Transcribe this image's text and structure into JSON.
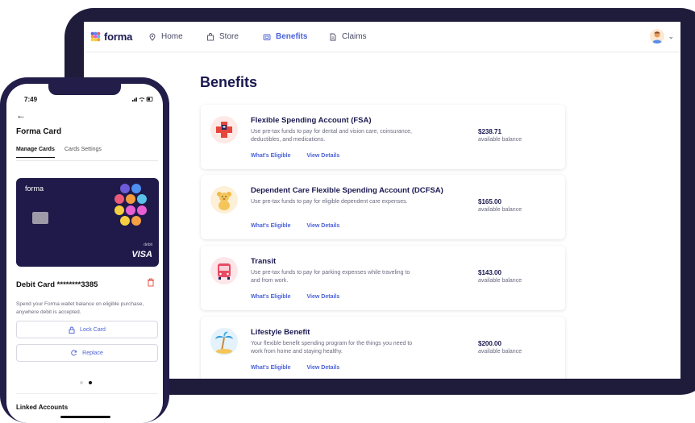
{
  "app": {
    "logo": "forma",
    "nav": [
      {
        "label": "Home",
        "icon": "location-pin-icon"
      },
      {
        "label": "Store",
        "icon": "shopping-bag-icon"
      },
      {
        "label": "Benefits",
        "icon": "wallet-icon",
        "active": true
      },
      {
        "label": "Claims",
        "icon": "document-icon"
      }
    ],
    "avatar_icon": "user-avatar-icon",
    "menu_icon": "chevron-down-icon"
  },
  "benefits_page": {
    "title": "Benefits",
    "cards": [
      {
        "name": "Flexible Spending Account (FSA)",
        "description": "Use pre-tax funds to pay for dental and vision care, coinsurance, deductibles, and medications.",
        "amount": "$238.71",
        "amount_label": "available balance",
        "link_eligible": "What's Eligible",
        "link_details": "View Details",
        "icon": "medical-cross-icon"
      },
      {
        "name": "Dependent Care Flexible Spending Account (DCFSA)",
        "description": "Use pre-tax funds to pay for eligible dependent care expenses.",
        "amount": "$165.00",
        "amount_label": "available balance",
        "link_eligible": "What's Eligible",
        "link_details": "View Details",
        "icon": "teddy-bear-icon"
      },
      {
        "name": "Transit",
        "description": "Use pre-tax funds to pay for parking expenses while traveling to and from work.",
        "amount": "$143.00",
        "amount_label": "available balance",
        "link_eligible": "What's Eligible",
        "link_details": "View Details",
        "icon": "bus-icon"
      },
      {
        "name": "Lifestyle Benefit",
        "description": "Your flexible benefit spending program for the things you need to work from home and staying healthy.",
        "amount": "$200.00",
        "amount_label": "available balance",
        "link_eligible": "What's Eligible",
        "link_details": "View Details",
        "icon": "palm-tree-icon"
      }
    ]
  },
  "phone": {
    "status_time": "7:49",
    "status_icons": "signal wifi battery",
    "back_icon": "back-arrow-icon",
    "title": "Forma Card",
    "tabs": [
      "Manage Cards",
      "Cards Settings"
    ],
    "card": {
      "brand": "forma",
      "type_label": "debit",
      "network": "VISA"
    },
    "debit_title": "Debit Card ********3385",
    "debit_description": "Spend your Forma wallet balance on eligible purchase, anywhere debit is accepted.",
    "lock_button": "Lock Card",
    "replace_button": "Replace",
    "linked_accounts": "Linked Accounts",
    "trash_icon": "trash-icon"
  },
  "colors": {
    "device_frame": "#1f1c3b",
    "brand_navy": "#1a1850",
    "link_blue": "#4b62d8",
    "card_bg": "#1f1a4a"
  }
}
